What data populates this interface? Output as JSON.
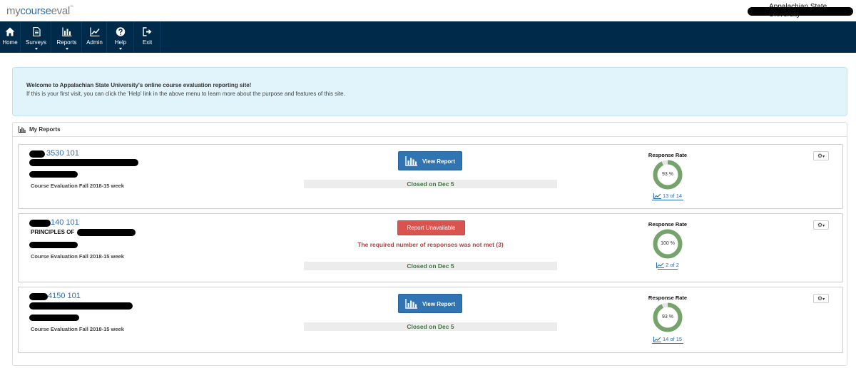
{
  "header": {
    "logo": {
      "my": "my",
      "course": "course",
      "eval": "eval",
      "tm": "™"
    },
    "university": "Appalachian State University"
  },
  "nav": [
    {
      "label": "Home",
      "icon": "home-icon",
      "dropdown": false
    },
    {
      "label": "Surveys",
      "icon": "document-icon",
      "dropdown": true
    },
    {
      "label": "Reports",
      "icon": "bar-chart-icon",
      "dropdown": true
    },
    {
      "label": "Admin",
      "icon": "line-chart-icon",
      "dropdown": false
    },
    {
      "label": "Help",
      "icon": "question-icon",
      "dropdown": true
    },
    {
      "label": "Exit",
      "icon": "exit-icon",
      "dropdown": false
    }
  ],
  "welcome": {
    "title": "Welcome to Appalachian State University's online course evaluation reporting site!",
    "body": "If this is your first visit, you can click the 'Help' link in the above menu to learn more about the purpose and features of this site."
  },
  "reports": {
    "title": "My Reports",
    "cards": [
      {
        "course_number": "3530 101",
        "subtitle": "",
        "eval_name": "Course Evaluation Fall 2018-15 week",
        "action": "view",
        "action_label": "View Report",
        "message": "",
        "closed": "Closed on Dec 5",
        "rr_label": "Response Rate",
        "rr_percent": "93 %",
        "rr_value": 0.93,
        "rr_count": "13 of 14"
      },
      {
        "course_number": "140 101",
        "subtitle": "PRINCIPLES OF",
        "eval_name": "Course Evaluation Fall 2018-15 week",
        "action": "unavailable",
        "action_label": "Report Unavailable",
        "message": "The required number of responses was not met (3)",
        "closed": "Closed on Dec 5",
        "rr_label": "Response Rate",
        "rr_percent": "100 %",
        "rr_value": 1.0,
        "rr_count": "2 of 2"
      },
      {
        "course_number": "4150 101",
        "subtitle": "",
        "eval_name": "Course Evaluation Fall 2018-15 week",
        "action": "view",
        "action_label": "View Report",
        "message": "",
        "closed": "Closed on Dec 5",
        "rr_label": "Response Rate",
        "rr_percent": "93 %",
        "rr_value": 0.93,
        "rr_count": "14 of 15"
      }
    ]
  },
  "colors": {
    "navy": "#002a4a",
    "link_blue": "#2a6fb3",
    "button_blue": "#3074b4",
    "danger_red": "#d9534f",
    "success_green": "#3c763d",
    "donut_green": "#76a36b"
  }
}
